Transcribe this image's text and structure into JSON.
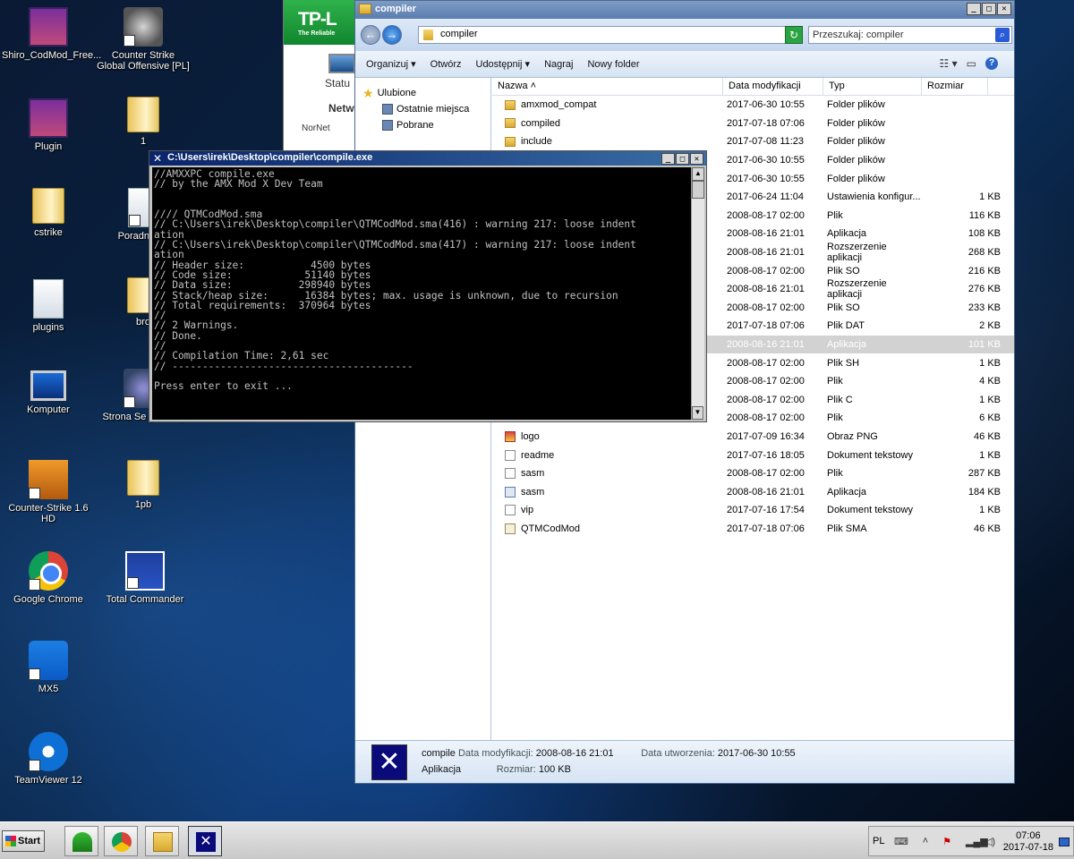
{
  "desktop": {
    "icons": [
      {
        "label": "Shiro_CodMod_Free..."
      },
      {
        "label": "Counter Strike Global Offensive [PL]"
      },
      {
        "label": "Plugin"
      },
      {
        "label": "1"
      },
      {
        "label": "cstrike"
      },
      {
        "label": "Poradniki C"
      },
      {
        "label": "plugins"
      },
      {
        "label": "bro"
      },
      {
        "label": "Komputer"
      },
      {
        "label": "Strona Se (Forum)"
      },
      {
        "label": "Counter-Strike 1.6 HD"
      },
      {
        "label": "1pb"
      },
      {
        "label": "Google Chrome"
      },
      {
        "label": "Total Commander"
      },
      {
        "label": "MX5"
      },
      {
        "label": "TeamViewer 12"
      }
    ]
  },
  "tplink": {
    "logo": "TP-L",
    "tagline": "The Reliable",
    "status": "Statu",
    "network": "Netw",
    "nor": "NorNet"
  },
  "explorer": {
    "title": "compiler",
    "address": "compiler",
    "search_placeholder": "Przeszukaj: compiler",
    "toolbar": {
      "organize": "Organizuj ▾",
      "open": "Otwórz",
      "share": "Udostępnij ▾",
      "burn": "Nagraj",
      "new_folder": "Nowy folder"
    },
    "nav": {
      "favorites": "Ulubione",
      "recent": "Ostatnie miejsca",
      "downloads": "Pobrane"
    },
    "columns": {
      "name": "Nazwa",
      "date": "Data modyfikacji",
      "type": "Typ",
      "size": "Rozmiar"
    },
    "files": [
      {
        "name": "amxmod_compat",
        "date": "2017-06-30 10:55",
        "type": "Folder plików",
        "size": ""
      },
      {
        "name": "compiled",
        "date": "2017-07-18 07:06",
        "type": "Folder plików",
        "size": ""
      },
      {
        "name": "include",
        "date": "2017-07-08 11:23",
        "type": "Folder plików",
        "size": ""
      },
      {
        "name": "",
        "date": "2017-06-30 10:55",
        "type": "Folder plików",
        "size": ""
      },
      {
        "name": "",
        "date": "2017-06-30 10:55",
        "type": "Folder plików",
        "size": ""
      },
      {
        "name": "",
        "date": "2017-06-24 11:04",
        "type": "Ustawienia konfigur...",
        "size": "1 KB"
      },
      {
        "name": "",
        "date": "2008-08-17 02:00",
        "type": "Plik",
        "size": "116 KB"
      },
      {
        "name": "",
        "date": "2008-08-16 21:01",
        "type": "Aplikacja",
        "size": "108 KB"
      },
      {
        "name": "",
        "date": "2008-08-16 21:01",
        "type": "Rozszerzenie aplikacji",
        "size": "268 KB"
      },
      {
        "name": "",
        "date": "2008-08-17 02:00",
        "type": "Plik SO",
        "size": "216 KB"
      },
      {
        "name": "",
        "date": "2008-08-16 21:01",
        "type": "Rozszerzenie aplikacji",
        "size": "276 KB"
      },
      {
        "name": "",
        "date": "2008-08-17 02:00",
        "type": "Plik SO",
        "size": "233 KB"
      },
      {
        "name": "",
        "date": "2017-07-18 07:06",
        "type": "Plik DAT",
        "size": "2 KB"
      },
      {
        "name": "",
        "date": "2008-08-16 21:01",
        "type": "Aplikacja",
        "size": "101 KB"
      },
      {
        "name": "",
        "date": "2008-08-17 02:00",
        "type": "Plik SH",
        "size": "1 KB"
      },
      {
        "name": "",
        "date": "2008-08-17 02:00",
        "type": "Plik",
        "size": "4 KB"
      },
      {
        "name": "",
        "date": "2008-08-17 02:00",
        "type": "Plik C",
        "size": "1 KB"
      },
      {
        "name": "",
        "date": "2008-08-17 02:00",
        "type": "Plik",
        "size": "6 KB"
      },
      {
        "name": "logo",
        "date": "2017-07-09 16:34",
        "type": "Obraz PNG",
        "size": "46 KB"
      },
      {
        "name": "readme",
        "date": "2017-07-16 18:05",
        "type": "Dokument tekstowy",
        "size": "1 KB"
      },
      {
        "name": "sasm",
        "date": "2008-08-17 02:00",
        "type": "Plik",
        "size": "287 KB"
      },
      {
        "name": "sasm",
        "date": "2008-08-16 21:01",
        "type": "Aplikacja",
        "size": "184 KB"
      },
      {
        "name": "vip",
        "date": "2017-07-16 17:54",
        "type": "Dokument tekstowy",
        "size": "1 KB"
      },
      {
        "name": "QTMCodMod",
        "date": "2017-07-18 07:06",
        "type": "Plik SMA",
        "size": "46 KB"
      }
    ],
    "selected_index": 13,
    "details": {
      "name": "compile",
      "modified_label": "Data modyfikacji:",
      "modified": "2008-08-16 21:01",
      "created_label": "Data utworzenia:",
      "created": "2017-06-30 10:55",
      "type": "Aplikacja",
      "size_label": "Rozmiar:",
      "size": "100 KB"
    }
  },
  "console": {
    "title": "C:\\Users\\irek\\Desktop\\compiler\\compile.exe",
    "text": "//AMXXPC compile.exe\n// by the AMX Mod X Dev Team\n\n\n//// QTMCodMod.sma\n// C:\\Users\\irek\\Desktop\\compiler\\QTMCodMod.sma(416) : warning 217: loose indent\nation\n// C:\\Users\\irek\\Desktop\\compiler\\QTMCodMod.sma(417) : warning 217: loose indent\nation\n// Header size:           4500 bytes\n// Code size:            51140 bytes\n// Data size:           298940 bytes\n// Stack/heap size:      16384 bytes; max. usage is unknown, due to recursion\n// Total requirements:  370964 bytes\n//\n// 2 Warnings.\n// Done.\n//\n// Compilation Time: 2,61 sec\n// ----------------------------------------\n\nPress enter to exit ..."
  },
  "taskbar": {
    "start": "Start",
    "lang": "PL",
    "time": "07:06",
    "date": "2017-07-18"
  }
}
